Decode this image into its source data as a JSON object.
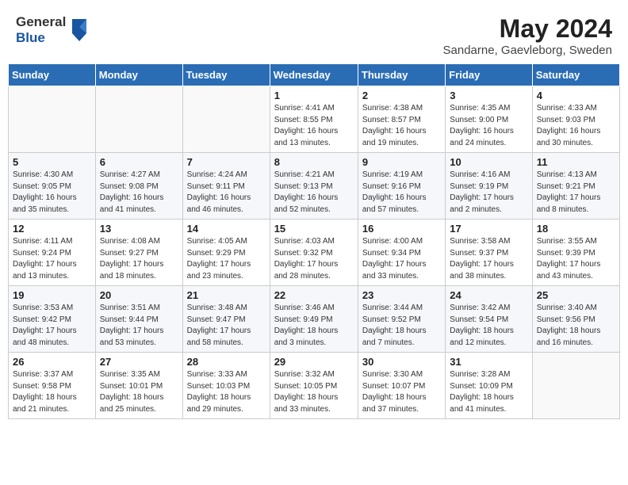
{
  "logo": {
    "text_general": "General",
    "text_blue": "Blue"
  },
  "header": {
    "month_year": "May 2024",
    "location": "Sandarne, Gaevleborg, Sweden"
  },
  "days_of_week": [
    "Sunday",
    "Monday",
    "Tuesday",
    "Wednesday",
    "Thursday",
    "Friday",
    "Saturday"
  ],
  "weeks": [
    [
      {
        "day": "",
        "info": ""
      },
      {
        "day": "",
        "info": ""
      },
      {
        "day": "",
        "info": ""
      },
      {
        "day": "1",
        "info": "Sunrise: 4:41 AM\nSunset: 8:55 PM\nDaylight: 16 hours\nand 13 minutes."
      },
      {
        "day": "2",
        "info": "Sunrise: 4:38 AM\nSunset: 8:57 PM\nDaylight: 16 hours\nand 19 minutes."
      },
      {
        "day": "3",
        "info": "Sunrise: 4:35 AM\nSunset: 9:00 PM\nDaylight: 16 hours\nand 24 minutes."
      },
      {
        "day": "4",
        "info": "Sunrise: 4:33 AM\nSunset: 9:03 PM\nDaylight: 16 hours\nand 30 minutes."
      }
    ],
    [
      {
        "day": "5",
        "info": "Sunrise: 4:30 AM\nSunset: 9:05 PM\nDaylight: 16 hours\nand 35 minutes."
      },
      {
        "day": "6",
        "info": "Sunrise: 4:27 AM\nSunset: 9:08 PM\nDaylight: 16 hours\nand 41 minutes."
      },
      {
        "day": "7",
        "info": "Sunrise: 4:24 AM\nSunset: 9:11 PM\nDaylight: 16 hours\nand 46 minutes."
      },
      {
        "day": "8",
        "info": "Sunrise: 4:21 AM\nSunset: 9:13 PM\nDaylight: 16 hours\nand 52 minutes."
      },
      {
        "day": "9",
        "info": "Sunrise: 4:19 AM\nSunset: 9:16 PM\nDaylight: 16 hours\nand 57 minutes."
      },
      {
        "day": "10",
        "info": "Sunrise: 4:16 AM\nSunset: 9:19 PM\nDaylight: 17 hours\nand 2 minutes."
      },
      {
        "day": "11",
        "info": "Sunrise: 4:13 AM\nSunset: 9:21 PM\nDaylight: 17 hours\nand 8 minutes."
      }
    ],
    [
      {
        "day": "12",
        "info": "Sunrise: 4:11 AM\nSunset: 9:24 PM\nDaylight: 17 hours\nand 13 minutes."
      },
      {
        "day": "13",
        "info": "Sunrise: 4:08 AM\nSunset: 9:27 PM\nDaylight: 17 hours\nand 18 minutes."
      },
      {
        "day": "14",
        "info": "Sunrise: 4:05 AM\nSunset: 9:29 PM\nDaylight: 17 hours\nand 23 minutes."
      },
      {
        "day": "15",
        "info": "Sunrise: 4:03 AM\nSunset: 9:32 PM\nDaylight: 17 hours\nand 28 minutes."
      },
      {
        "day": "16",
        "info": "Sunrise: 4:00 AM\nSunset: 9:34 PM\nDaylight: 17 hours\nand 33 minutes."
      },
      {
        "day": "17",
        "info": "Sunrise: 3:58 AM\nSunset: 9:37 PM\nDaylight: 17 hours\nand 38 minutes."
      },
      {
        "day": "18",
        "info": "Sunrise: 3:55 AM\nSunset: 9:39 PM\nDaylight: 17 hours\nand 43 minutes."
      }
    ],
    [
      {
        "day": "19",
        "info": "Sunrise: 3:53 AM\nSunset: 9:42 PM\nDaylight: 17 hours\nand 48 minutes."
      },
      {
        "day": "20",
        "info": "Sunrise: 3:51 AM\nSunset: 9:44 PM\nDaylight: 17 hours\nand 53 minutes."
      },
      {
        "day": "21",
        "info": "Sunrise: 3:48 AM\nSunset: 9:47 PM\nDaylight: 17 hours\nand 58 minutes."
      },
      {
        "day": "22",
        "info": "Sunrise: 3:46 AM\nSunset: 9:49 PM\nDaylight: 18 hours\nand 3 minutes."
      },
      {
        "day": "23",
        "info": "Sunrise: 3:44 AM\nSunset: 9:52 PM\nDaylight: 18 hours\nand 7 minutes."
      },
      {
        "day": "24",
        "info": "Sunrise: 3:42 AM\nSunset: 9:54 PM\nDaylight: 18 hours\nand 12 minutes."
      },
      {
        "day": "25",
        "info": "Sunrise: 3:40 AM\nSunset: 9:56 PM\nDaylight: 18 hours\nand 16 minutes."
      }
    ],
    [
      {
        "day": "26",
        "info": "Sunrise: 3:37 AM\nSunset: 9:58 PM\nDaylight: 18 hours\nand 21 minutes."
      },
      {
        "day": "27",
        "info": "Sunrise: 3:35 AM\nSunset: 10:01 PM\nDaylight: 18 hours\nand 25 minutes."
      },
      {
        "day": "28",
        "info": "Sunrise: 3:33 AM\nSunset: 10:03 PM\nDaylight: 18 hours\nand 29 minutes."
      },
      {
        "day": "29",
        "info": "Sunrise: 3:32 AM\nSunset: 10:05 PM\nDaylight: 18 hours\nand 33 minutes."
      },
      {
        "day": "30",
        "info": "Sunrise: 3:30 AM\nSunset: 10:07 PM\nDaylight: 18 hours\nand 37 minutes."
      },
      {
        "day": "31",
        "info": "Sunrise: 3:28 AM\nSunset: 10:09 PM\nDaylight: 18 hours\nand 41 minutes."
      },
      {
        "day": "",
        "info": ""
      }
    ]
  ]
}
